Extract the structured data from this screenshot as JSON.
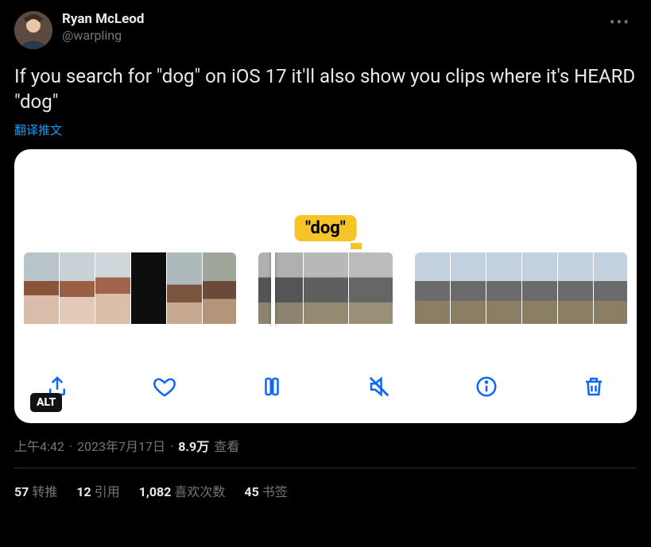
{
  "author": {
    "display_name": "Ryan McLeod",
    "handle": "@warpling"
  },
  "tweet_text": "If you search for \"dog\" on iOS 17 it'll also show you clips where it's HEARD \"dog\"",
  "translate_label": "翻译推文",
  "media": {
    "search_bubble": "\"dog\"",
    "alt_label": "ALT"
  },
  "meta": {
    "time": "上午4:42",
    "dot1": "·",
    "date": "2023年7月17日",
    "dot2": "·",
    "views_count": "8.9万",
    "views_label": "查看"
  },
  "stats": {
    "retweets_count": "57",
    "retweets_label": "转推",
    "quotes_count": "12",
    "quotes_label": "引用",
    "likes_count": "1,082",
    "likes_label": "喜欢次数",
    "bookmarks_count": "45",
    "bookmarks_label": "书签"
  }
}
